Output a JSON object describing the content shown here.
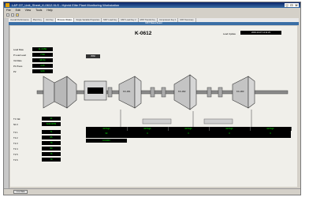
{
  "window": {
    "title": "L&P GT_Unit_Sheet_K-0612.XLS - Hybrid Elite Plant Monitoring Workstation",
    "controls": [
      "_",
      "□",
      "x"
    ]
  },
  "menu": [
    "File",
    "Edit",
    "View",
    "Tools",
    "Help"
  ],
  "tabs": [
    {
      "label": "Overall Performance",
      "active": false
    },
    {
      "label": "Plant Key",
      "active": false
    },
    {
      "label": "Unit Key",
      "active": false
    },
    {
      "label": "Process Status",
      "active": true
    },
    {
      "label": "Single Variable Properties",
      "active": false
    },
    {
      "label": "MST Load Key",
      "active": false
    },
    {
      "label": "MST Load Key 2",
      "active": false
    },
    {
      "label": "MST Trends Key",
      "active": false
    },
    {
      "label": "Compressor Key 1",
      "active": false
    },
    {
      "label": "MST Summary",
      "active": false
    }
  ],
  "subtitle": "MST Status Board",
  "canvas": {
    "machine_id": "K-0612",
    "load_label": "Load Update",
    "load_value": "2003-10-07 14:11:23",
    "params_left": [
      {
        "label": "Load Rate",
        "value": "11.4 MW"
      },
      {
        "label": "P Load Lead",
        "value": "7700"
      },
      {
        "label": "Vol Rate",
        "value": "98.5%"
      },
      {
        "label": "P1 Press",
        "value": "2.45"
      },
      {
        "label": "P2",
        "value": "9.80"
      }
    ],
    "turbine_speed": "3560",
    "params_lower": [
      {
        "label": "T1 Intk",
        "value": "41"
      },
      {
        "label": "N1 F",
        "value": "6100 RPM"
      },
      {
        "label": "T2 1",
        "value": "71"
      },
      {
        "label": "T2 2",
        "value": "85"
      },
      {
        "label": "T2 3",
        "value": "78"
      },
      {
        "label": "T2 4",
        "value": "83"
      },
      {
        "label": "T2 5",
        "value": "76"
      },
      {
        "label": "T2 6",
        "value": "79"
      }
    ],
    "compressors": [
      "KC-301",
      "KC-302",
      "KC-303"
    ],
    "grid_headers": [
      "KP High",
      "KP High",
      "KP High",
      "KP High",
      "KP High"
    ],
    "grid_values": [
      "90",
      "0",
      "0",
      "0",
      "0"
    ],
    "grid_extra": "0.9 DRV"
  },
  "status": {
    "button": "Live Data"
  }
}
